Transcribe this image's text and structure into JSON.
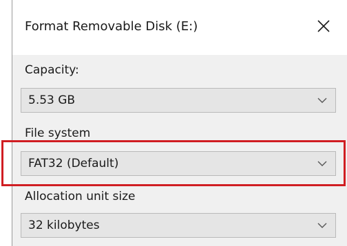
{
  "dialog": {
    "title": "Format Removable Disk (E:)",
    "close_icon": "close-icon"
  },
  "capacity": {
    "label": "Capacity:",
    "value": "5.53 GB"
  },
  "file_system": {
    "label": "File system",
    "value": "FAT32 (Default)"
  },
  "allocation_unit": {
    "label": "Allocation unit size",
    "value": "32 kilobytes"
  },
  "colors": {
    "highlight": "#d01d22",
    "dialog_bg": "#f0f0f0",
    "combo_bg": "#e5e5e5"
  }
}
